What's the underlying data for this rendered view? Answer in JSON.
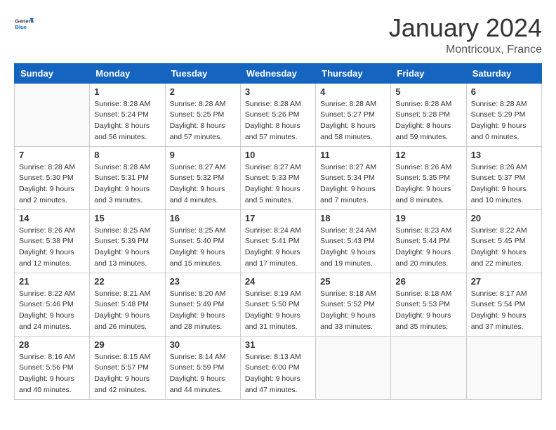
{
  "header": {
    "logo_general": "General",
    "logo_blue": "Blue",
    "month": "January 2024",
    "location": "Montricoux, France"
  },
  "days_of_week": [
    "Sunday",
    "Monday",
    "Tuesday",
    "Wednesday",
    "Thursday",
    "Friday",
    "Saturday"
  ],
  "weeks": [
    [
      {
        "day": "",
        "info": ""
      },
      {
        "day": "1",
        "info": "Sunrise: 8:28 AM\nSunset: 5:24 PM\nDaylight: 8 hours\nand 56 minutes."
      },
      {
        "day": "2",
        "info": "Sunrise: 8:28 AM\nSunset: 5:25 PM\nDaylight: 8 hours\nand 57 minutes."
      },
      {
        "day": "3",
        "info": "Sunrise: 8:28 AM\nSunset: 5:26 PM\nDaylight: 8 hours\nand 57 minutes."
      },
      {
        "day": "4",
        "info": "Sunrise: 8:28 AM\nSunset: 5:27 PM\nDaylight: 8 hours\nand 58 minutes."
      },
      {
        "day": "5",
        "info": "Sunrise: 8:28 AM\nSunset: 5:28 PM\nDaylight: 8 hours\nand 59 minutes."
      },
      {
        "day": "6",
        "info": "Sunrise: 8:28 AM\nSunset: 5:29 PM\nDaylight: 9 hours\nand 0 minutes."
      }
    ],
    [
      {
        "day": "7",
        "info": "Sunrise: 8:28 AM\nSunset: 5:30 PM\nDaylight: 9 hours\nand 2 minutes."
      },
      {
        "day": "8",
        "info": "Sunrise: 8:28 AM\nSunset: 5:31 PM\nDaylight: 9 hours\nand 3 minutes."
      },
      {
        "day": "9",
        "info": "Sunrise: 8:27 AM\nSunset: 5:32 PM\nDaylight: 9 hours\nand 4 minutes."
      },
      {
        "day": "10",
        "info": "Sunrise: 8:27 AM\nSunset: 5:33 PM\nDaylight: 9 hours\nand 5 minutes."
      },
      {
        "day": "11",
        "info": "Sunrise: 8:27 AM\nSunset: 5:34 PM\nDaylight: 9 hours\nand 7 minutes."
      },
      {
        "day": "12",
        "info": "Sunrise: 8:26 AM\nSunset: 5:35 PM\nDaylight: 9 hours\nand 8 minutes."
      },
      {
        "day": "13",
        "info": "Sunrise: 8:26 AM\nSunset: 5:37 PM\nDaylight: 9 hours\nand 10 minutes."
      }
    ],
    [
      {
        "day": "14",
        "info": "Sunrise: 8:26 AM\nSunset: 5:38 PM\nDaylight: 9 hours\nand 12 minutes."
      },
      {
        "day": "15",
        "info": "Sunrise: 8:25 AM\nSunset: 5:39 PM\nDaylight: 9 hours\nand 13 minutes."
      },
      {
        "day": "16",
        "info": "Sunrise: 8:25 AM\nSunset: 5:40 PM\nDaylight: 9 hours\nand 15 minutes."
      },
      {
        "day": "17",
        "info": "Sunrise: 8:24 AM\nSunset: 5:41 PM\nDaylight: 9 hours\nand 17 minutes."
      },
      {
        "day": "18",
        "info": "Sunrise: 8:24 AM\nSunset: 5:43 PM\nDaylight: 9 hours\nand 19 minutes."
      },
      {
        "day": "19",
        "info": "Sunrise: 8:23 AM\nSunset: 5:44 PM\nDaylight: 9 hours\nand 20 minutes."
      },
      {
        "day": "20",
        "info": "Sunrise: 8:22 AM\nSunset: 5:45 PM\nDaylight: 9 hours\nand 22 minutes."
      }
    ],
    [
      {
        "day": "21",
        "info": "Sunrise: 8:22 AM\nSunset: 5:46 PM\nDaylight: 9 hours\nand 24 minutes."
      },
      {
        "day": "22",
        "info": "Sunrise: 8:21 AM\nSunset: 5:48 PM\nDaylight: 9 hours\nand 26 minutes."
      },
      {
        "day": "23",
        "info": "Sunrise: 8:20 AM\nSunset: 5:49 PM\nDaylight: 9 hours\nand 28 minutes."
      },
      {
        "day": "24",
        "info": "Sunrise: 8:19 AM\nSunset: 5:50 PM\nDaylight: 9 hours\nand 31 minutes."
      },
      {
        "day": "25",
        "info": "Sunrise: 8:18 AM\nSunset: 5:52 PM\nDaylight: 9 hours\nand 33 minutes."
      },
      {
        "day": "26",
        "info": "Sunrise: 8:18 AM\nSunset: 5:53 PM\nDaylight: 9 hours\nand 35 minutes."
      },
      {
        "day": "27",
        "info": "Sunrise: 8:17 AM\nSunset: 5:54 PM\nDaylight: 9 hours\nand 37 minutes."
      }
    ],
    [
      {
        "day": "28",
        "info": "Sunrise: 8:16 AM\nSunset: 5:56 PM\nDaylight: 9 hours\nand 40 minutes."
      },
      {
        "day": "29",
        "info": "Sunrise: 8:15 AM\nSunset: 5:57 PM\nDaylight: 9 hours\nand 42 minutes."
      },
      {
        "day": "30",
        "info": "Sunrise: 8:14 AM\nSunset: 5:59 PM\nDaylight: 9 hours\nand 44 minutes."
      },
      {
        "day": "31",
        "info": "Sunrise: 8:13 AM\nSunset: 6:00 PM\nDaylight: 9 hours\nand 47 minutes."
      },
      {
        "day": "",
        "info": ""
      },
      {
        "day": "",
        "info": ""
      },
      {
        "day": "",
        "info": ""
      }
    ]
  ]
}
